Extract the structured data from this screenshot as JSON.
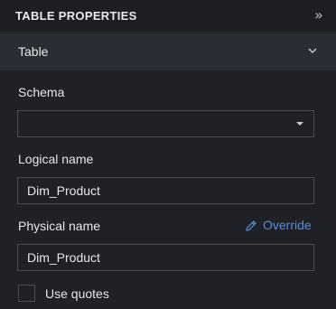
{
  "header": {
    "title": "TABLE PROPERTIES",
    "collapse_icon": "double-chevron-right-icon"
  },
  "section": {
    "label": "Table",
    "icon": "chevron-down-icon"
  },
  "schema": {
    "label": "Schema",
    "value": "",
    "icon": "caret-down-icon"
  },
  "logical_name": {
    "label": "Logical name",
    "value": "Dim_Product"
  },
  "physical_name": {
    "label": "Physical name",
    "value": "Dim_Product",
    "override_label": "Override",
    "override_icon": "pencil-icon"
  },
  "use_quotes": {
    "label": "Use quotes",
    "checked": false
  },
  "colors": {
    "background": "#1f2126",
    "section_bar": "#2a2d33",
    "link": "#5b8bd6",
    "border": "#4a4d55"
  }
}
